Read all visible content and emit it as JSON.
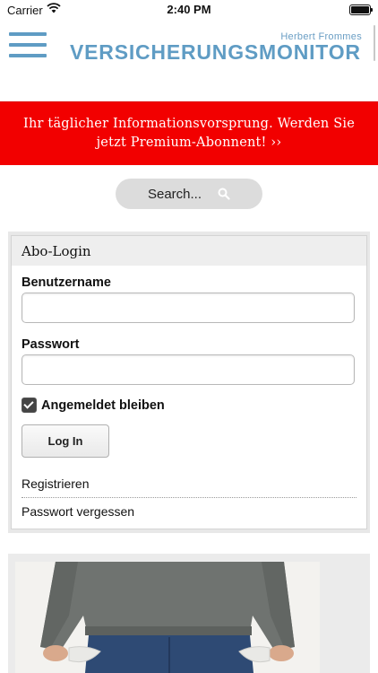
{
  "status": {
    "carrier": "Carrier",
    "time": "2:40 PM"
  },
  "header": {
    "brand_sub": "Herbert Frommes",
    "brand_main": "VERSICHERUNGSMONITOR",
    "accent_color": "#5f9cc4"
  },
  "banner": {
    "text": "Ihr täglicher Informationsvorsprung. Werden Sie jetzt Premium-Abonnent! ››",
    "color": "#f20000"
  },
  "search": {
    "placeholder": "Search..."
  },
  "login": {
    "title": "Abo-Login",
    "username_label": "Benutzername",
    "username_value": "",
    "password_label": "Passwort",
    "password_value": "",
    "remember_label": "Angemeldet bleiben",
    "remember_checked": true,
    "button_label": "Log In",
    "links": [
      "Registrieren",
      "Passwort vergessen"
    ]
  },
  "icons": [
    "wifi-icon",
    "battery-icon",
    "menu-icon",
    "search-icon",
    "checkbox-icon"
  ]
}
